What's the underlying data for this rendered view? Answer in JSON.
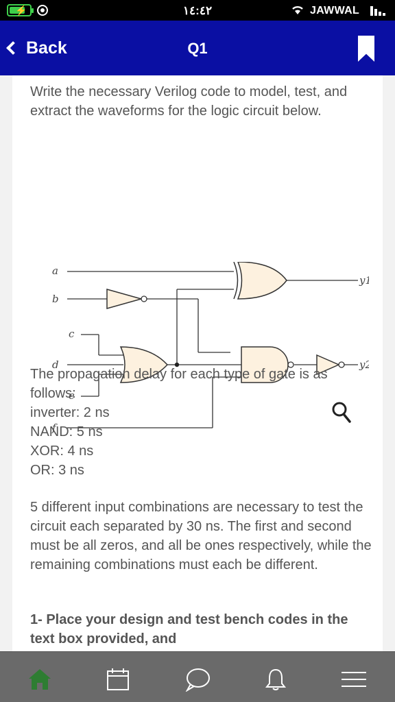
{
  "status_bar": {
    "time": "١٤:٤٢",
    "carrier": "JAWWAL"
  },
  "header": {
    "back_label": "Back",
    "title": "Q1"
  },
  "question": {
    "intro": "Write the necessary Verilog code to model, test, and extract the waveforms for the logic circuit below.",
    "delay_heading": "The propagation delay for each type of gate is as follows:",
    "delays": [
      "inverter:  2 ns",
      "NAND: 5 ns",
      "XOR: 4 ns",
      "OR: 3 ns"
    ],
    "combinations": "5 different input combinations are necessary to test the circuit each separated by  30 ns. The first and second must be all zeros, and all be ones respectively, while the remaining combinations must each be different.",
    "task": "1- Place your design and test bench codes in the text box provided, and"
  },
  "circuit": {
    "inputs": [
      "a",
      "b",
      "c",
      "d",
      "e",
      "f"
    ],
    "outputs": [
      "y1",
      "y2"
    ],
    "gates": [
      "XOR",
      "inverter",
      "OR",
      "NAND",
      "inverter"
    ]
  },
  "bottom_nav": {
    "items": [
      "home-icon",
      "calendar-icon",
      "chat-icon",
      "bell-icon",
      "menu-icon"
    ],
    "active_color": "#2e7d32"
  },
  "colors": {
    "header_bg": "#0a0fa3",
    "gate_fill": "#fdf1df"
  }
}
